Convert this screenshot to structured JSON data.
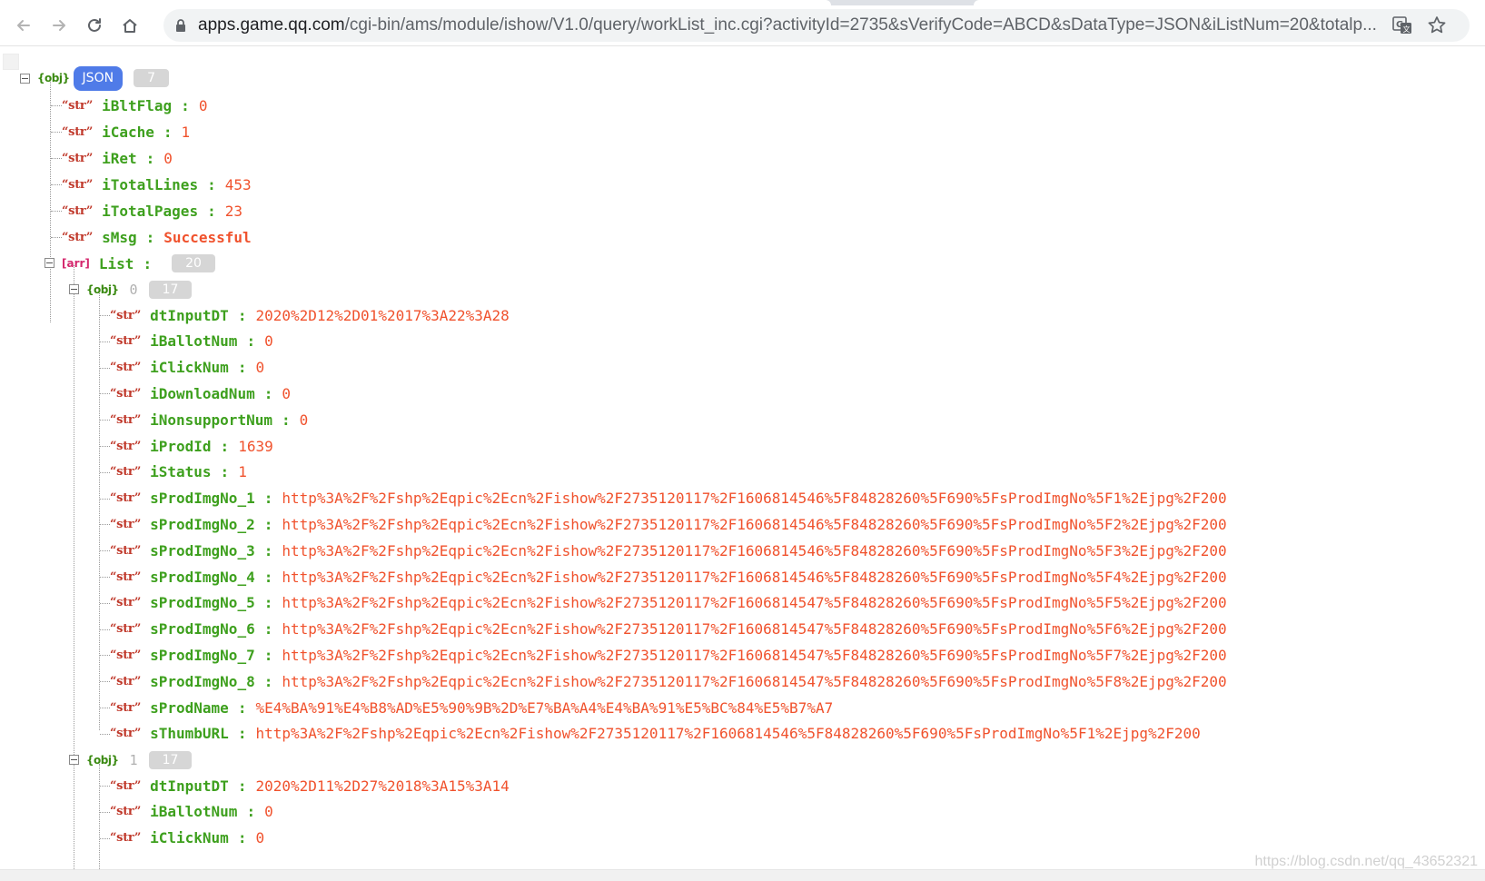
{
  "browser": {
    "url_host": "apps.game.qq.com",
    "url_rest": "/cgi-bin/ams/module/ishow/V1.0/query/workList_inc.cgi?activityId=2735&sVerifyCode=ABCD&sDataType=JSON&iListNum=20&totalp..."
  },
  "viewer": {
    "root": {
      "tag": "{obj}",
      "badge": "JSON",
      "count": "7"
    },
    "top_fields": [
      {
        "tag": "“str”",
        "key": "iBltFlag",
        "value": "0"
      },
      {
        "tag": "“str”",
        "key": "iCache",
        "value": "1"
      },
      {
        "tag": "“str”",
        "key": "iRet",
        "value": "0"
      },
      {
        "tag": "“str”",
        "key": "iTotalLines",
        "value": "453"
      },
      {
        "tag": "“str”",
        "key": "iTotalPages",
        "value": "23"
      },
      {
        "tag": "“str”",
        "key": "sMsg",
        "value": "Successful"
      }
    ],
    "list": {
      "tag": "[arr]",
      "key": "List",
      "count": "20"
    },
    "items": [
      {
        "tag": "{obj}",
        "index": "0",
        "count": "17",
        "fields": [
          {
            "tag": "“str”",
            "key": "dtInputDT",
            "value": "2020%2D12%2D01%2017%3A22%3A28"
          },
          {
            "tag": "“str”",
            "key": "iBallotNum",
            "value": "0"
          },
          {
            "tag": "“str”",
            "key": "iClickNum",
            "value": "0"
          },
          {
            "tag": "“str”",
            "key": "iDownloadNum",
            "value": "0"
          },
          {
            "tag": "“str”",
            "key": "iNonsupportNum",
            "value": "0"
          },
          {
            "tag": "“str”",
            "key": "iProdId",
            "value": "1639"
          },
          {
            "tag": "“str”",
            "key": "iStatus",
            "value": "1"
          },
          {
            "tag": "“str”",
            "key": "sProdImgNo_1",
            "value": "http%3A%2F%2Fshp%2Eqpic%2Ecn%2Fishow%2F2735120117%2F1606814546%5F84828260%5F690%5FsProdImgNo%5F1%2Ejpg%2F200"
          },
          {
            "tag": "“str”",
            "key": "sProdImgNo_2",
            "value": "http%3A%2F%2Fshp%2Eqpic%2Ecn%2Fishow%2F2735120117%2F1606814546%5F84828260%5F690%5FsProdImgNo%5F2%2Ejpg%2F200"
          },
          {
            "tag": "“str”",
            "key": "sProdImgNo_3",
            "value": "http%3A%2F%2Fshp%2Eqpic%2Ecn%2Fishow%2F2735120117%2F1606814546%5F84828260%5F690%5FsProdImgNo%5F3%2Ejpg%2F200"
          },
          {
            "tag": "“str”",
            "key": "sProdImgNo_4",
            "value": "http%3A%2F%2Fshp%2Eqpic%2Ecn%2Fishow%2F2735120117%2F1606814546%5F84828260%5F690%5FsProdImgNo%5F4%2Ejpg%2F200"
          },
          {
            "tag": "“str”",
            "key": "sProdImgNo_5",
            "value": "http%3A%2F%2Fshp%2Eqpic%2Ecn%2Fishow%2F2735120117%2F1606814547%5F84828260%5F690%5FsProdImgNo%5F5%2Ejpg%2F200"
          },
          {
            "tag": "“str”",
            "key": "sProdImgNo_6",
            "value": "http%3A%2F%2Fshp%2Eqpic%2Ecn%2Fishow%2F2735120117%2F1606814547%5F84828260%5F690%5FsProdImgNo%5F6%2Ejpg%2F200"
          },
          {
            "tag": "“str”",
            "key": "sProdImgNo_7",
            "value": "http%3A%2F%2Fshp%2Eqpic%2Ecn%2Fishow%2F2735120117%2F1606814547%5F84828260%5F690%5FsProdImgNo%5F7%2Ejpg%2F200"
          },
          {
            "tag": "“str”",
            "key": "sProdImgNo_8",
            "value": "http%3A%2F%2Fshp%2Eqpic%2Ecn%2Fishow%2F2735120117%2F1606814547%5F84828260%5F690%5FsProdImgNo%5F8%2Ejpg%2F200"
          },
          {
            "tag": "“str”",
            "key": "sProdName",
            "value": "%E4%BA%91%E4%B8%AD%E5%90%9B%2D%E7%BA%A4%E4%BA%91%E5%BC%84%E5%B7%A7"
          },
          {
            "tag": "“str”",
            "key": "sThumbURL",
            "value": "http%3A%2F%2Fshp%2Eqpic%2Ecn%2Fishow%2F2735120117%2F1606814546%5F84828260%5F690%5FsProdImgNo%5F1%2Ejpg%2F200"
          }
        ]
      },
      {
        "tag": "{obj}",
        "index": "1",
        "count": "17",
        "fields": [
          {
            "tag": "“str”",
            "key": "dtInputDT",
            "value": "2020%2D11%2D27%2018%3A15%3A14"
          },
          {
            "tag": "“str”",
            "key": "iBallotNum",
            "value": "0"
          },
          {
            "tag": "“str”",
            "key": "iClickNum",
            "value": "0"
          }
        ]
      }
    ]
  },
  "watermark": "https://blog.csdn.net/qq_43652321"
}
